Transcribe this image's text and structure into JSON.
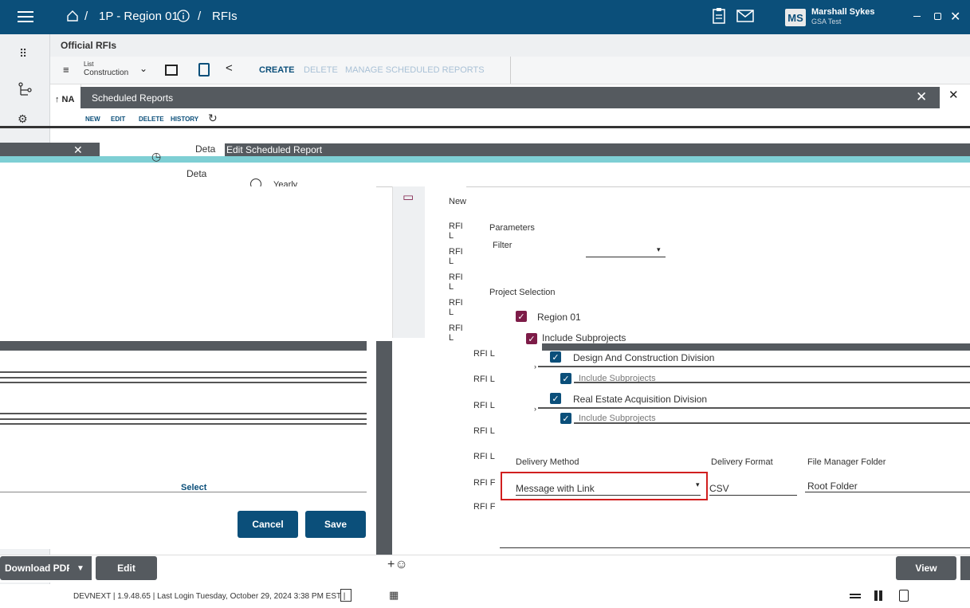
{
  "topbar": {
    "breadcrumb_project": "1P - Region 01",
    "breadcrumb_sep": "/",
    "breadcrumb_page": "RFIs",
    "user_initials": "MS",
    "user_name": "Marshall Sykes",
    "user_sub": "GSA Test",
    "icons": [
      "menu-icon",
      "home-icon",
      "info-icon",
      "clipboard-icon",
      "mail-icon",
      "minimize-icon",
      "restore-icon",
      "close-icon"
    ]
  },
  "page": {
    "title": "Official RFIs",
    "list_label_small": "List",
    "list_label": "Construction",
    "toolbar": {
      "create": "CREATE",
      "delete": "DELETE",
      "manage": "MANAGE SCHEDULED REPORTS"
    },
    "name_col": "↑ NA"
  },
  "scheduled_reports": {
    "title": "Scheduled Reports",
    "actions": {
      "new": "NEW",
      "edit": "EDIT",
      "delete": "DELETE",
      "history": "HISTORY"
    },
    "detail_1": "Deta",
    "detail_2": "Deta",
    "rows": [
      "New",
      "RFI L",
      "RFI L",
      "RFI L",
      "RFI L",
      "RFI L"
    ],
    "rows2": [
      "RFI L",
      "RFI L",
      "RFI L",
      "RFI L",
      "RFI L",
      "RFI F",
      "RFI F"
    ]
  },
  "edit_report": {
    "title": "Edit Scheduled Report",
    "yearly": "Yearly",
    "parameters": "Parameters",
    "filter": "Filter",
    "project_selection": "Project Selection",
    "region": "Region 01",
    "include_subprojects": "Include Subprojects",
    "division_1": "Design And Construction Division",
    "division_1_sub": "Include Subprojects",
    "division_2": "Real Estate Acquisition Division",
    "division_2_sub": "Include Subprojects",
    "delivery_method_label": "Delivery Method",
    "delivery_method_value": "Message with Link",
    "delivery_format_label": "Delivery Format",
    "delivery_format_value": "CSV",
    "folder_label": "File Manager Folder",
    "folder_value": "Root Folder",
    "highlight_color": "#d11f1f"
  },
  "left_panel": {
    "select": "Select",
    "cancel": "Cancel",
    "save": "Save"
  },
  "bottom": {
    "download_pdf": "Download PDF",
    "edit": "Edit",
    "view": "View",
    "status": "DEVNEXT | 1.9.48.65 | Last Login Tuesday, October 29, 2024 3:38 PM EST |"
  }
}
